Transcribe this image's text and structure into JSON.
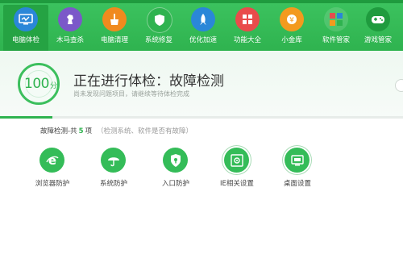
{
  "nav": {
    "tabs": [
      {
        "label": "电脑体检",
        "icon": "monitor-check-icon",
        "color": "#2a87d8"
      },
      {
        "label": "木马查杀",
        "icon": "horse-icon",
        "color": "#7b58c9"
      },
      {
        "label": "电脑清理",
        "icon": "broom-icon",
        "color": "#f08a1e"
      },
      {
        "label": "系统修复",
        "icon": "shield-icon",
        "color": "#2fb34f"
      },
      {
        "label": "优化加速",
        "icon": "rocket-icon",
        "color": "#2a87d8"
      },
      {
        "label": "功能大全",
        "icon": "grid-icon",
        "color": "#e94b4b"
      },
      {
        "label": "小金库",
        "icon": "coin-icon",
        "color": "#f39a1e"
      },
      {
        "label": "软件管家",
        "icon": "apps-icon",
        "color": "#e54e4e"
      },
      {
        "label": "游戏管家",
        "icon": "gamepad-icon",
        "color": "#2fb34f"
      }
    ]
  },
  "status": {
    "score": "100",
    "score_unit": "分",
    "title": "正在进行体检：故障检测",
    "subtitle": "尚未发现问题项目，请继续等待体检完成",
    "progress": 0.13
  },
  "section": {
    "title": "故障检测-共",
    "count": "5",
    "unit": "项",
    "note": "（检测系统、软件是否有故障）"
  },
  "items": [
    {
      "label": "浏览器防护",
      "icon": "browser-e-icon"
    },
    {
      "label": "系统防护",
      "icon": "umbrella-icon"
    },
    {
      "label": "入口防护",
      "icon": "shield-lock-icon"
    },
    {
      "label": "IE相关设置",
      "icon": "ie-settings-icon"
    },
    {
      "label": "桌面设置",
      "icon": "desktop-icon"
    }
  ],
  "colors": {
    "accent": "#2fb34f",
    "header": "#3cc35f"
  }
}
